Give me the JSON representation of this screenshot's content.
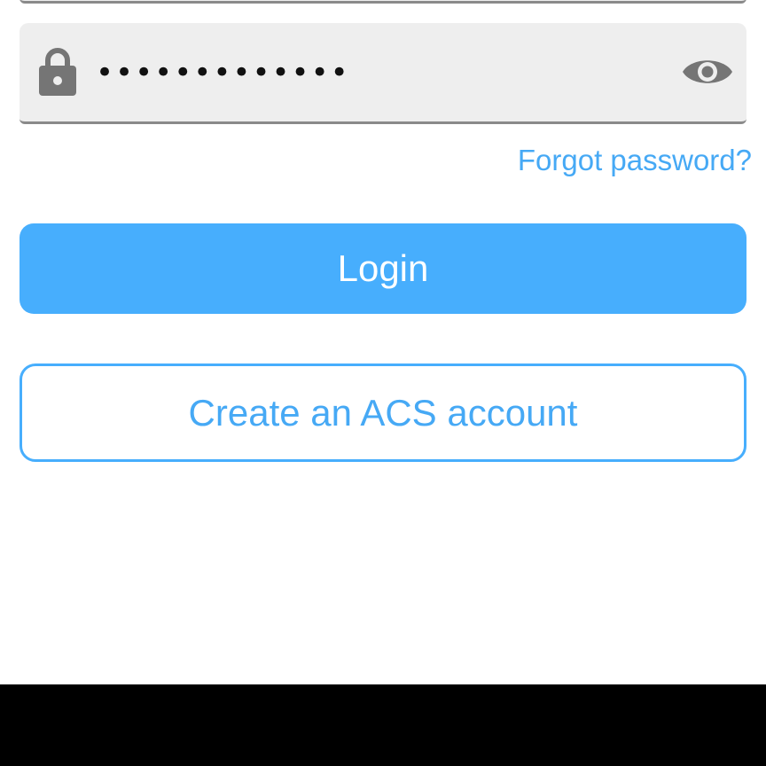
{
  "password_field": {
    "value": "•••••••••••••",
    "lock_icon": "lock-icon",
    "visibility_icon": "eye-icon"
  },
  "forgot_password": {
    "label": "Forgot password?"
  },
  "login_button": {
    "label": "Login"
  },
  "create_account_button": {
    "label": "Create an ACS account"
  },
  "colors": {
    "accent": "#47aefd",
    "link": "#46a9f5",
    "field_bg": "#eeeeee",
    "icon": "#757575",
    "system_bar": "#000000"
  }
}
